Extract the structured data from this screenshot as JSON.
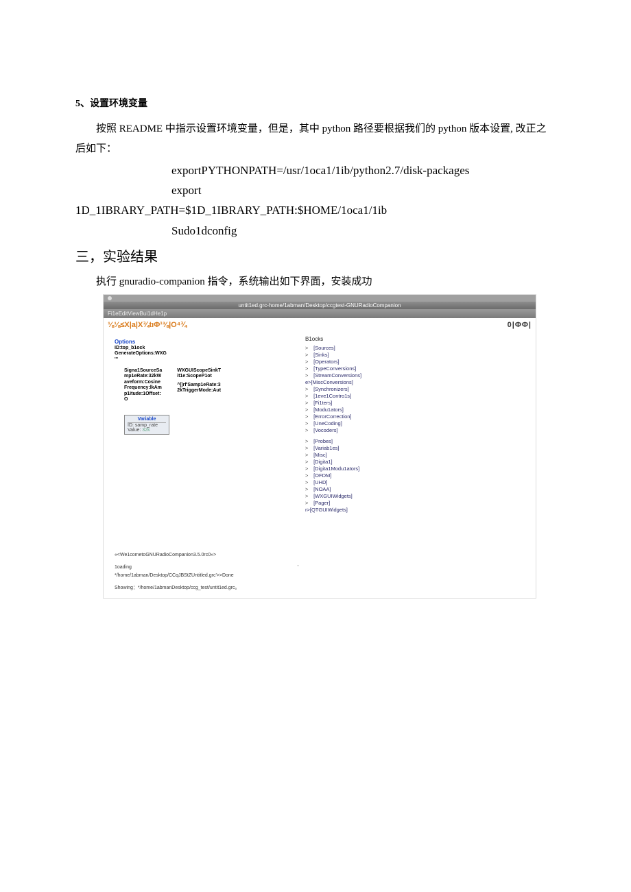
{
  "doc": {
    "heading5": "5、设置环境变量",
    "para1_a": "按照 README 中指示设置环境变量，但是，其中 python 路径要根据我们的 python 版本设置, 改正之后如下：",
    "code1": "exportPYTHONPATH=/usr/1oca1/1ib/python2.7/disk-packages",
    "code2": "export",
    "code3": "1D_1IBRARY_PATH=$1D_1IBRARY_PATH:$HOME/1oca1/1ib",
    "code4": "Sudo1dconfig",
    "section3": "三，实验结果",
    "para2": "执行 gnuradio-companion 指令，系统输出如下界面，安装成功"
  },
  "shot": {
    "titlebar": "untit1ed.grc-home/1abman/Desktop/ccgtest-GNURadioCompanion",
    "menubar": "Fi1eEditViewBui1dHe1p",
    "toolbar_left_glyphs": "⅛⅛≤X|a|X¾tıΦ¹⅜|O⁴¾",
    "toolbar_right_glyphs": "0|ΦΦ|",
    "options": {
      "title": "Options",
      "l1": "ID:top_b1ock",
      "l2": "GenerateOptions:WXG",
      "l3": "'''"
    },
    "signal": {
      "l1": "Signa1SourceSa",
      "l2": "mp1eRate:32kW",
      "l3": "aveform:Cosine",
      "l4": "Frequency:lkAm",
      "l5": "p1itude:1Offset:",
      "l6": "O"
    },
    "scope": {
      "l1": "WXGUIScopeSinkT",
      "l2": "it1e:ScopeP1ot",
      "l3": "^[|rf'Samp1eRate:3",
      "l4": "2kTriggerMode:Aut"
    },
    "variable": {
      "title": "Variable",
      "l1": "ID: samp_rate",
      "l2k": "Value:",
      "l2v": "32k"
    },
    "console": {
      "c1": "«<We1cometoGNURadioCompanion3.5.0rc0»>",
      "c2": "1oading",
      "c2b": "'",
      "c3": "*/home/1abman/Desktop/CCqJBStZUntitled.grc'>>Done",
      "c4": "Showing：*/home/1abmanDesktop/ccg_test/untit1ed.grc。"
    },
    "blocks_title": "B1ocks",
    "tree1": [
      "[Sources]",
      "[Sinks]",
      "[Operators]",
      "[TypeConversions]",
      "[StreamConversions]"
    ],
    "tree1b": "e>[MiscConversions]",
    "tree1c": [
      "[Synchronizers]",
      "[1eve1Contro1s]",
      "[Fi1ters]",
      "[Modu1ators]",
      "[ErrorCorrection]",
      "[UneCoding]",
      "[Vocoders]"
    ],
    "tree2": [
      "[Probes]",
      "[Variab1es]",
      "[Misc]",
      "[Digita1]",
      "[Digita1Modu1ators]",
      "[OFDM]",
      "[UHD]",
      "[NOAA]",
      "[WXGUIWidgets]",
      "[Pager]"
    ],
    "tree2b": "r>[QTGUIWidgets]"
  }
}
